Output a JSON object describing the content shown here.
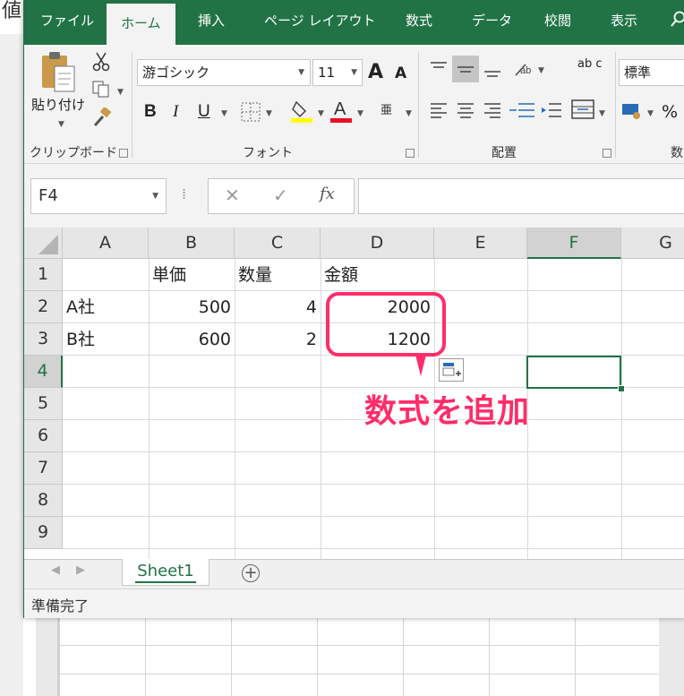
{
  "background": {
    "title_fragment": "値"
  },
  "ribbon_tabs": [
    "ファイル",
    "ホーム",
    "挿入",
    "ページ レイアウト",
    "数式",
    "データ",
    "校閲",
    "表示"
  ],
  "active_tab": "ホーム",
  "clipboard": {
    "paste_label": "貼り付け",
    "group_label": "クリップボード"
  },
  "font": {
    "name": "游ゴシック",
    "size": "11",
    "group_label": "フォント",
    "grow": "A",
    "shrink": "A",
    "bold": "B",
    "italic": "I",
    "underline": "U",
    "highlight_color": "#ffff00",
    "font_color": "#e81123"
  },
  "alignment": {
    "group_label": "配置",
    "wrap_icon_text": "ab c"
  },
  "number": {
    "format": "標準",
    "group_label": "数",
    "percent": "%"
  },
  "formula_bar": {
    "name_box": "F4",
    "cancel": "✕",
    "enter": "✓",
    "fx": "fx",
    "formula": ""
  },
  "columns": [
    "A",
    "B",
    "C",
    "D",
    "E",
    "F",
    "G"
  ],
  "rows": [
    "1",
    "2",
    "3",
    "4",
    "5",
    "6",
    "7",
    "8",
    "9"
  ],
  "cells": {
    "B1": "単価",
    "C1": "数量",
    "D1": "金額",
    "A2": "A社",
    "B2": "500",
    "C2": "4",
    "D2": "2000",
    "A3": "B社",
    "B3": "600",
    "C3": "2",
    "D3": "1200"
  },
  "selected_cell": "F4",
  "annotation": {
    "text": "数式を追加",
    "color": "#ff2d6a"
  },
  "sheets": [
    "Sheet1"
  ],
  "status": "準備完了",
  "colors": {
    "excel_green": "#217346"
  }
}
